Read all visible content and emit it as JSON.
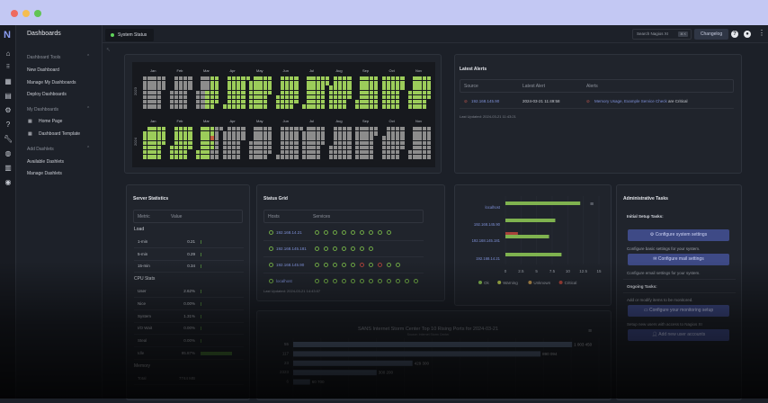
{
  "window": {
    "lights": [
      "#ee6a5f",
      "#f5bd4f",
      "#61c454"
    ]
  },
  "app": {
    "logo": "N",
    "page_title": "Dashboards",
    "system_status": "System Status",
    "search_placeholder": "Search Nagios XI",
    "search_shortcut": "⌘ K",
    "changelog": "Changelog"
  },
  "rail": [
    "home-icon",
    "grid-icon",
    "dashboard-icon",
    "reports-icon",
    "gear-icon",
    "help-icon",
    "wrench-icon",
    "globe-icon",
    "building-icon",
    "user-icon"
  ],
  "sidebar": {
    "sections": [
      {
        "label": "Dashboard Tools",
        "items": [
          "New Dashboard",
          "Manage My Dashboards",
          "Deploy Dashboards"
        ]
      },
      {
        "label": "My Dashboards",
        "items": [
          "Home Page",
          "Dashboard Template"
        ]
      },
      {
        "label": "Add Dashlets",
        "items": [
          "Available Dashlets",
          "Manage Dashlets"
        ]
      }
    ]
  },
  "heatmap": {
    "months": [
      "Jan",
      "Feb",
      "Mar",
      "Apr",
      "May",
      "Jun",
      "Jul",
      "Aug",
      "Sep",
      "Oct",
      "Nov"
    ],
    "years": [
      "2023",
      "2024"
    ],
    "ok_from": "2023-03-15",
    "ok_to": "2024-03-21",
    "critical_days": [
      "2024-03-19"
    ],
    "colors": {
      "ok": "#9ccc5a",
      "none": "#8c8c8c",
      "critical": "#c0603f"
    }
  },
  "alerts": {
    "title": "Latest Alerts",
    "headers": [
      "Source",
      "Latest Alert",
      "Alerts"
    ],
    "row": {
      "source": "192.168.145.90",
      "time": "2024-03-21 11:49:58",
      "services": "Memory Usage, Example Service Check",
      "suffix": "are Critical"
    },
    "updated": "Last Updated: 2024-03-21 11:43:21"
  },
  "server_stats": {
    "title": "Server Statistics",
    "headers": [
      "Metric",
      "Value"
    ],
    "rows": [
      {
        "group": "Load"
      },
      {
        "label": "1-min",
        "value": "0.21",
        "pct": 2
      },
      {
        "label": "5-min",
        "value": "0.29",
        "pct": 2
      },
      {
        "label": "15-min",
        "value": "0.34",
        "pct": 2
      },
      {
        "group": "CPU Stats"
      },
      {
        "label": "User",
        "value": "2.62%",
        "pct": 2.6
      },
      {
        "label": "Nice",
        "value": "0.00%",
        "pct": 0
      },
      {
        "label": "System",
        "value": "1.31%",
        "pct": 1.3
      },
      {
        "label": "I/O Wait",
        "value": "0.00%",
        "pct": 0
      },
      {
        "label": "Steal",
        "value": "0.00%",
        "pct": 0
      },
      {
        "label": "Idle",
        "value": "95.87%",
        "pct": 95.9
      },
      {
        "group": "Memory"
      },
      {
        "label": "Total",
        "value": "7744 MB"
      }
    ]
  },
  "status_grid": {
    "title": "Status Grid",
    "headers": [
      "Hosts",
      "Services"
    ],
    "rows": [
      {
        "host": "192.168.14.21",
        "services": [
          "ok",
          "ok",
          "ok",
          "ok",
          "ok",
          "ok",
          "ok",
          "ok",
          "ok"
        ]
      },
      {
        "host": "192.168.145.181",
        "services": [
          "ok",
          "ok",
          "ok",
          "ok",
          "ok",
          "ok",
          "ok"
        ]
      },
      {
        "host": "192.168.145.90",
        "services": [
          "ok",
          "ok",
          "ok",
          "ok",
          "ok",
          "critical",
          "ok",
          "critical",
          "ok",
          "ok"
        ]
      },
      {
        "host": "localhost",
        "services": [
          "ok",
          "ok",
          "ok",
          "ok",
          "ok",
          "ok",
          "ok",
          "ok",
          "ok",
          "ok",
          "ok",
          "ok"
        ]
      }
    ],
    "updated": "Last Updated: 2024-03-21 14:43:07"
  },
  "chart_data": [
    {
      "type": "bar",
      "orientation": "horizontal",
      "categories": [
        "localhost",
        "192.168.145.90",
        "192.168.145.181",
        "192.168.14.21"
      ],
      "series": [
        {
          "name": "Ok",
          "color": "#7fb24f",
          "values": [
            12,
            8,
            7,
            9
          ]
        },
        {
          "name": "Warning",
          "color": "#a8b84a",
          "values": [
            0,
            0,
            0,
            0
          ]
        },
        {
          "name": "Unknown",
          "color": "#b08a4a",
          "values": [
            0,
            0,
            0,
            0
          ]
        },
        {
          "name": "Critical",
          "color": "#a8423a",
          "values": [
            0,
            2,
            0,
            0
          ]
        }
      ],
      "xticks": [
        "0",
        "2.5",
        "5",
        "7.5",
        "10",
        "12.5",
        "15"
      ],
      "xlim": [
        0,
        15
      ],
      "legend": "bottom",
      "grid": true
    },
    {
      "type": "bar",
      "orientation": "horizontal",
      "title": "SANS Internet Storm Center Top 10 Rising Ports for 2024-03-21",
      "subtitle": "Source: Internet Storm Center",
      "categories": [
        "55",
        "117",
        "23",
        "2323",
        "6"
      ],
      "values": [
        1003450,
        890094,
        429300,
        300200,
        60700
      ],
      "labels": [
        "1 003 450",
        "890 094",
        "429 300",
        "300 200",
        "60 700"
      ],
      "xlim": [
        0,
        1100000
      ],
      "grid": true
    }
  ],
  "admin": {
    "title": "Administrative Tasks",
    "initial": "Initial Setup Tasks:",
    "btn_system": "Configure system settings",
    "desc_system": "Configure basic settings for your system.",
    "btn_mail": "Configure mail settings",
    "desc_mail": "Configure email settings for your system.",
    "ongoing": "Ongoing Tasks:",
    "desc_monitor": "Add or modify items to be monitored.",
    "btn_monitor": "Configure your monitoring setup",
    "desc_users": "Setup new users with access to Nagios XI",
    "btn_users": "Add new user accounts"
  }
}
